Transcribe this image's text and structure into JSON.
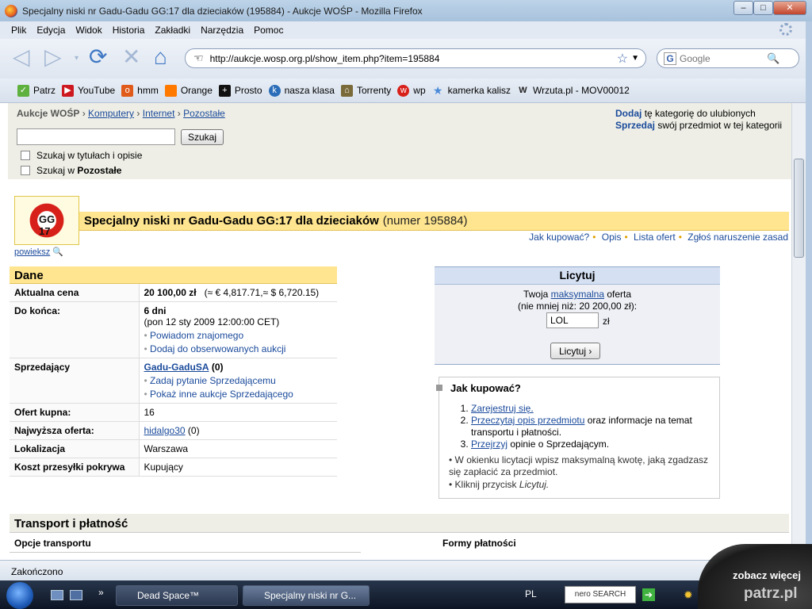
{
  "window": {
    "title": "Specjalny niski nr Gadu-Gadu GG:17 dla dzieciaków (195884) - Aukcje WOŚP - Mozilla Firefox"
  },
  "menu": [
    "Plik",
    "Edycja",
    "Widok",
    "Historia",
    "Zakładki",
    "Narzędzia",
    "Pomoc"
  ],
  "navbar": {
    "url": "http://aukcje.wosp.org.pl/show_item.php?item=195884",
    "search_placeholder": "Google"
  },
  "bookmarks": [
    {
      "label": "Patrz",
      "icon": "patrz-icon",
      "color": "#5fb13d"
    },
    {
      "label": "YouTube",
      "icon": "youtube-icon",
      "color": "#cc181e"
    },
    {
      "label": "hmm",
      "icon": "onet-icon",
      "color": "#e05a1a"
    },
    {
      "label": "Orange",
      "icon": "orange-icon",
      "color": "#ff7900"
    },
    {
      "label": "Prosto",
      "icon": "prosto-icon",
      "color": "#111111"
    },
    {
      "label": "nasza klasa",
      "icon": "nk-icon",
      "color": "#2b6db8"
    },
    {
      "label": "Torrenty",
      "icon": "torrent-icon",
      "color": "#7a6a3a"
    },
    {
      "label": "wp",
      "icon": "wp-icon",
      "color": "#d8201a"
    },
    {
      "label": "kamerka kalisz",
      "icon": "star-icon",
      "color": "#4a8ad8"
    },
    {
      "label": "Wrzuta.pl - MOV00012",
      "icon": "wrzuta-icon",
      "color": "#222222"
    }
  ],
  "search": {
    "crumb": {
      "root": "Aukcje WOŚP",
      "c1": "Komputery",
      "c2": "Internet",
      "c3": "Pozostałe"
    },
    "button": "Szukaj",
    "opt1": "Szukaj w tytułach i opisie",
    "opt2_prefix": "Szukaj w",
    "opt2_cat": "Pozostałe",
    "fav_link": "Dodaj",
    "fav_text": "tę kategorię do ulubionych",
    "sell_link": "Sprzedaj",
    "sell_text": "swój przedmiot w tej kategorii"
  },
  "item": {
    "logo_text": "GG 17",
    "enlarge": "powieksz",
    "title": "Specjalny niski nr Gadu-Gadu GG:17 dla dzieciaków",
    "number": "(numer 195884)",
    "links": [
      "Jak kupować?",
      "Opis",
      "Lista ofert",
      "Zgłoś naruszenie zasad"
    ]
  },
  "dane": {
    "header": "Dane",
    "price_label": "Aktualna cena",
    "price": "20 100,00 zł",
    "price_conv": "(≈ € 4,817.71,≈ $ 6,720.15)",
    "end_label": "Do końca:",
    "end_days": "6 dni",
    "end_date": "(pon 12 sty 2009 12:00:00 CET)",
    "notify": "Powiadom znajomego",
    "watch": "Dodaj do obserwowanych aukcji",
    "seller_label": "Sprzedający",
    "seller": "Gadu-GaduSA",
    "seller_score": "(0)",
    "ask": "Zadaj pytanie Sprzedającemu",
    "others": "Pokaż inne aukcje Sprzedającego",
    "offers_label": "Ofert kupna:",
    "offers": "16",
    "top_label": "Najwyższa oferta:",
    "top_user": "hidalgo30",
    "top_score": "(0)",
    "loc_label": "Lokalizacja",
    "loc": "Warszawa",
    "ship_label": "Koszt przesyłki pokrywa",
    "ship": "Kupujący"
  },
  "bid": {
    "header": "Licytuj",
    "l1a": "Twoja",
    "l1link": "maksymalna",
    "l1b": "oferta",
    "l2": "(nie mniej niż: 20 200,00 zł):",
    "value": "LOL",
    "currency": "zł",
    "button": "Licytuj ›"
  },
  "how": {
    "title": "Jak kupować?",
    "s1": "Zarejestruj się.",
    "s2link": "Przeczytaj opis przedmiotu",
    "s2": "oraz informacje na temat transportu i płatności.",
    "s3link": "Przejrzyj",
    "s3": "opinie o Sprzedającym.",
    "b1": "W okienku licytacji wpisz maksymalną kwotę, jaką zgadzasz się zapłacić za przedmiot.",
    "b2a": "Kliknij przycisk",
    "b2i": "Licytuj."
  },
  "transport": {
    "header": "Transport i płatność",
    "options": "Opcje transportu",
    "payments": "Formy płatności"
  },
  "status": "Zakończono",
  "taskbar": {
    "t1": "Dead Space™",
    "t2": "Specjalny niski nr G...",
    "lang": "PL",
    "nero": "nero SEARCH"
  },
  "promo": {
    "line1": "zobacz więcej",
    "line2": "patrz.pl"
  }
}
